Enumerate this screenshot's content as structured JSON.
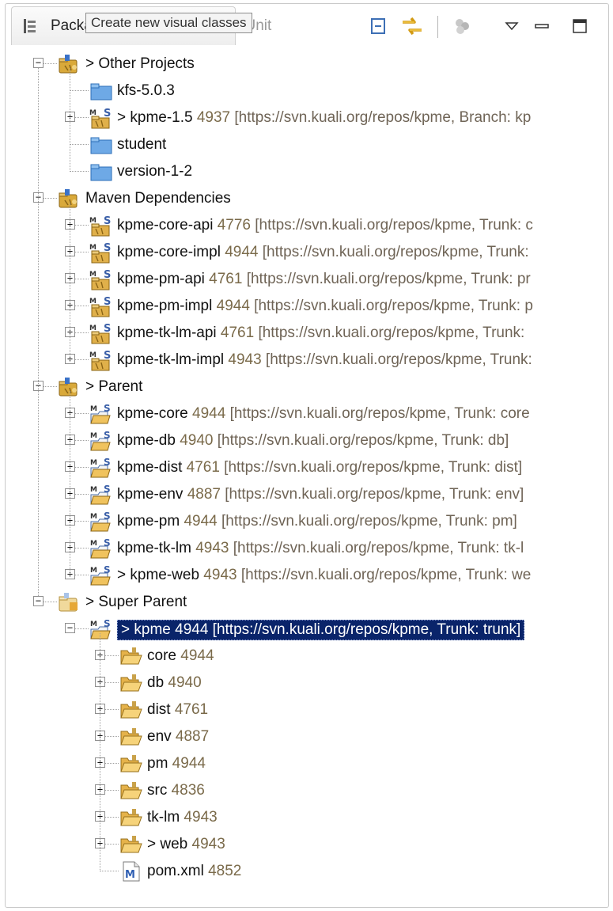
{
  "header": {
    "view_title": "Package Explorer",
    "close_glyph": "⊠",
    "junit_tab": "JUnit",
    "tooltip": "Create new visual classes",
    "toolbar": {
      "collapse_all": "collapse-all-icon",
      "link_with_editor": "link-with-editor-icon",
      "disabled_action": "disabled-action-icon",
      "view_menu": "view-menu-icon",
      "minimize": "minimize-icon",
      "maximize": "maximize-icon"
    }
  },
  "tree": {
    "other_projects": {
      "label": "> Other Projects",
      "children": [
        {
          "name": "kfs-5.0.3"
        },
        {
          "name": "> kpme-1.5",
          "rev": "4937",
          "url": "[https://svn.kuali.org/repos/kpme, Branch: kp"
        },
        {
          "name": "student"
        },
        {
          "name": "version-1-2"
        }
      ]
    },
    "maven_dependencies": {
      "label": "Maven Dependencies",
      "children": [
        {
          "name": "kpme-core-api",
          "rev": "4776",
          "url": "[https://svn.kuali.org/repos/kpme, Trunk: c"
        },
        {
          "name": "kpme-core-impl",
          "rev": "4944",
          "url": "[https://svn.kuali.org/repos/kpme, Trunk:"
        },
        {
          "name": "kpme-pm-api",
          "rev": "4761",
          "url": "[https://svn.kuali.org/repos/kpme, Trunk: pr"
        },
        {
          "name": "kpme-pm-impl",
          "rev": "4944",
          "url": "[https://svn.kuali.org/repos/kpme, Trunk: p"
        },
        {
          "name": "kpme-tk-lm-api",
          "rev": "4761",
          "url": "[https://svn.kuali.org/repos/kpme, Trunk:"
        },
        {
          "name": "kpme-tk-lm-impl",
          "rev": "4943",
          "url": "[https://svn.kuali.org/repos/kpme, Trunk:"
        }
      ]
    },
    "parent": {
      "label": "> Parent",
      "children": [
        {
          "name": "kpme-core",
          "rev": "4944",
          "url": "[https://svn.kuali.org/repos/kpme, Trunk: core"
        },
        {
          "name": "kpme-db",
          "rev": "4940",
          "url": "[https://svn.kuali.org/repos/kpme, Trunk: db]"
        },
        {
          "name": "kpme-dist",
          "rev": "4761",
          "url": "[https://svn.kuali.org/repos/kpme, Trunk: dist]"
        },
        {
          "name": "kpme-env",
          "rev": "4887",
          "url": "[https://svn.kuali.org/repos/kpme, Trunk: env]"
        },
        {
          "name": "kpme-pm",
          "rev": "4944",
          "url": "[https://svn.kuali.org/repos/kpme, Trunk: pm]"
        },
        {
          "name": "kpme-tk-lm",
          "rev": "4943",
          "url": "[https://svn.kuali.org/repos/kpme, Trunk: tk-l"
        },
        {
          "name": "> kpme-web",
          "rev": "4943",
          "url": "[https://svn.kuali.org/repos/kpme, Trunk: we"
        }
      ]
    },
    "super_parent": {
      "label": "> Super Parent",
      "kpme": {
        "name": "> kpme",
        "rev": "4944",
        "url": "[https://svn.kuali.org/repos/kpme, Trunk: trunk]"
      },
      "children": [
        {
          "name": "core",
          "rev": "4944"
        },
        {
          "name": "db",
          "rev": "4940"
        },
        {
          "name": "dist",
          "rev": "4761"
        },
        {
          "name": "env",
          "rev": "4887"
        },
        {
          "name": "pm",
          "rev": "4944"
        },
        {
          "name": "src",
          "rev": "4836"
        },
        {
          "name": "tk-lm",
          "rev": "4943"
        },
        {
          "name": "> web",
          "rev": "4943"
        },
        {
          "name": "pom.xml",
          "rev": "4852"
        }
      ]
    }
  },
  "colors": {
    "selection": "#0a246a",
    "revision_text": "#7a6a4a",
    "folder_yellow": "#e8b84a",
    "folder_blue": "#4a90d9"
  }
}
